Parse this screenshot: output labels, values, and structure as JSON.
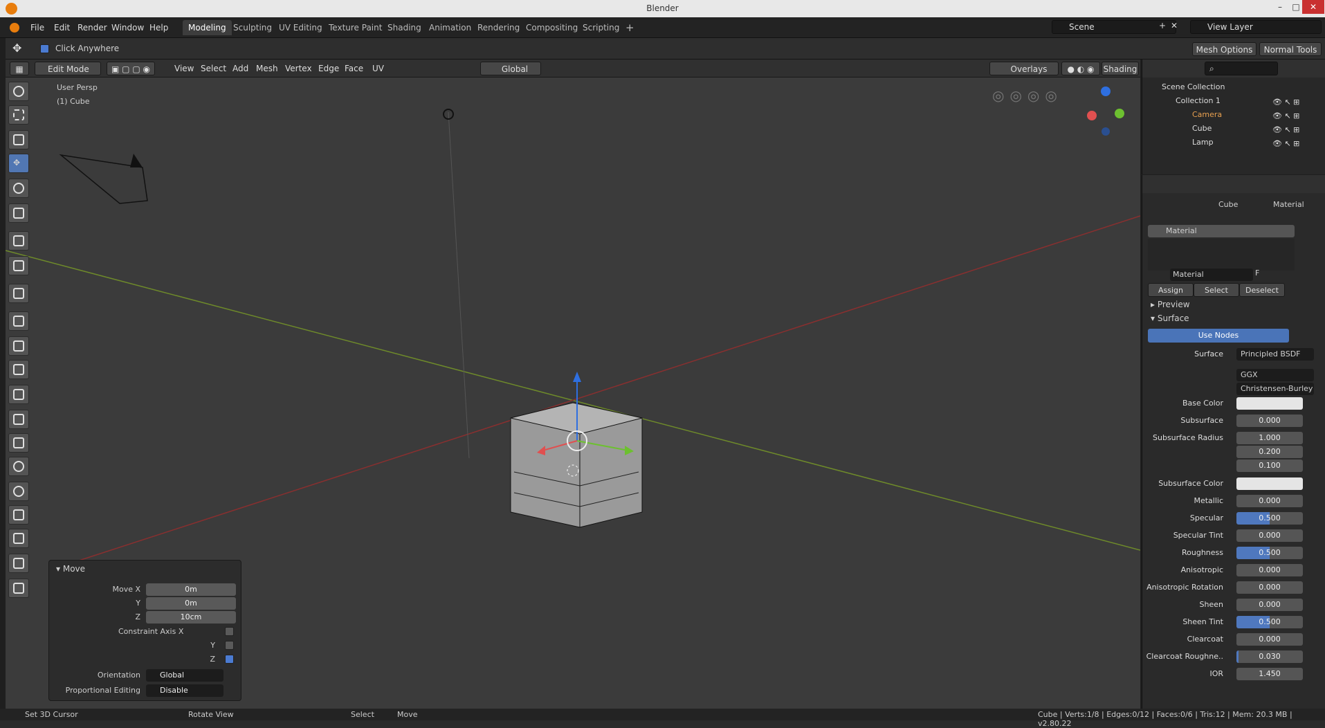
{
  "title": "Blender",
  "menu": [
    "File",
    "Edit",
    "Render",
    "Window",
    "Help"
  ],
  "workspaces": [
    "Modeling",
    "Sculpting",
    "UV Editing",
    "Texture Paint",
    "Shading",
    "Animation",
    "Rendering",
    "Compositing",
    "Scripting"
  ],
  "scene": "Scene",
  "view_layer": "View Layer",
  "tool_label": "Click Anywhere",
  "mesh_options": "Mesh Options",
  "normal_tools": "Normal Tools",
  "header": {
    "mode": "Edit Mode",
    "view": "View",
    "select": "Select",
    "add": "Add",
    "mesh": "Mesh",
    "vertex": "Vertex",
    "edge": "Edge",
    "face": "Face",
    "uv": "UV",
    "orientation": "Global",
    "overlays": "Overlays",
    "shading": "Shading"
  },
  "viewport": {
    "persp": "User Persp",
    "object": "(1) Cube"
  },
  "move_panel": {
    "title": "Move",
    "move_x_label": "Move X",
    "y_label": "Y",
    "z_label": "Z",
    "x": "0m",
    "y": "0m",
    "z": "10cm",
    "constraint": "Constraint Axis X",
    "cy": "Y",
    "cz": "Z",
    "orientation_label": "Orientation",
    "orientation": "Global",
    "proportional_label": "Proportional Editing",
    "proportional": "Disable"
  },
  "outliner": {
    "scene_collection": "Scene Collection",
    "collection": "Collection 1",
    "camera": "Camera",
    "cube": "Cube",
    "lamp": "Lamp"
  },
  "props": {
    "crumb_obj": "Cube",
    "crumb_mat": "Material",
    "slot": "Material",
    "mat_name": "Material",
    "f": "F",
    "assign": "Assign",
    "select": "Select",
    "deselect": "Deselect",
    "preview": "Preview",
    "surface_panel": "Surface",
    "use_nodes": "Use Nodes",
    "surface_label": "Surface",
    "surface_val": "Principled BSDF",
    "ggx": "GGX",
    "burley": "Christensen-Burley",
    "rows": [
      {
        "label": "Base Color",
        "val": "",
        "type": "white"
      },
      {
        "label": "Subsurface",
        "val": "0.000"
      },
      {
        "label": "Subsurface Radius",
        "val": "1.000"
      },
      {
        "label": "",
        "val": "0.200"
      },
      {
        "label": "",
        "val": "0.100"
      },
      {
        "label": "Subsurface Color",
        "val": "",
        "type": "white"
      },
      {
        "label": "Metallic",
        "val": "0.000"
      },
      {
        "label": "Specular",
        "val": "0.500",
        "type": "fill"
      },
      {
        "label": "Specular Tint",
        "val": "0.000"
      },
      {
        "label": "Roughness",
        "val": "0.500",
        "type": "fill"
      },
      {
        "label": "Anisotropic",
        "val": "0.000"
      },
      {
        "label": "Anisotropic Rotation",
        "val": "0.000"
      },
      {
        "label": "Sheen",
        "val": "0.000"
      },
      {
        "label": "Sheen Tint",
        "val": "0.500",
        "type": "fill"
      },
      {
        "label": "Clearcoat",
        "val": "0.000"
      },
      {
        "label": "Clearcoat Roughne..",
        "val": "0.030",
        "type": "fill3"
      },
      {
        "label": "IOR",
        "val": "1.450"
      }
    ]
  },
  "status": {
    "cursor": "Set 3D Cursor",
    "rotate": "Rotate View",
    "select": "Select",
    "move": "Move",
    "stats": "Cube | Verts:1/8 | Edges:0/12 | Faces:0/6 | Tris:12 | Mem: 20.3 MB | v2.80.22"
  }
}
